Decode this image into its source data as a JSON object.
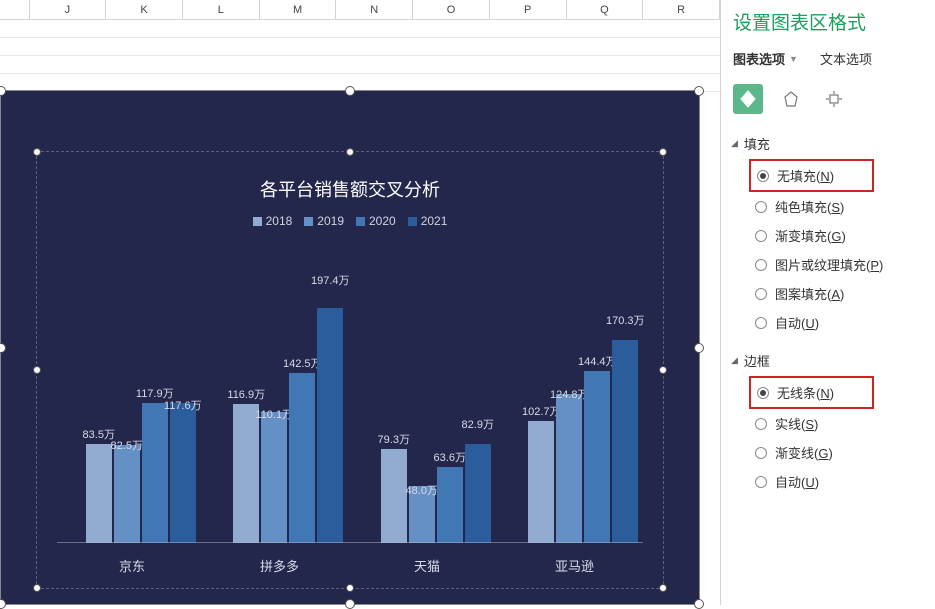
{
  "columns": [
    "J",
    "K",
    "L",
    "M",
    "N",
    "O",
    "P",
    "Q",
    "R"
  ],
  "chart_data": {
    "type": "bar",
    "title": "各平台销售额交叉分析",
    "categories": [
      "京东",
      "拼多多",
      "天猫",
      "亚马逊"
    ],
    "series": [
      {
        "name": "2018",
        "color": "#92abd1",
        "values": [
          83.5,
          116.9,
          79.3,
          102.7
        ]
      },
      {
        "name": "2019",
        "color": "#6590c5",
        "values": [
          82.5,
          110.1,
          48.0,
          124.8
        ]
      },
      {
        "name": "2020",
        "color": "#4277b6",
        "values": [
          117.9,
          142.5,
          63.6,
          144.4
        ]
      },
      {
        "name": "2021",
        "color": "#2b5c9b",
        "values": [
          117.6,
          197.4,
          82.9,
          170.3
        ]
      }
    ],
    "unit_suffix": "万"
  },
  "panel": {
    "title": "设置图表区格式",
    "tabs": {
      "chart_options": "图表选项",
      "text_options": "文本选项"
    },
    "sections": {
      "fill": {
        "label": "填充",
        "options": {
          "none": "无填充",
          "solid": "纯色填充",
          "gradient": "渐变填充",
          "picture": "图片或纹理填充",
          "pattern": "图案填充",
          "auto": "自动"
        },
        "keys": {
          "none": "N",
          "solid": "S",
          "gradient": "G",
          "picture": "P",
          "pattern": "A",
          "auto": "U"
        }
      },
      "border": {
        "label": "边框",
        "options": {
          "none": "无线条",
          "solid": "实线",
          "gradient": "渐变线",
          "auto": "自动"
        },
        "keys": {
          "none": "N",
          "solid": "S",
          "gradient": "G",
          "auto": "U"
        }
      }
    }
  }
}
